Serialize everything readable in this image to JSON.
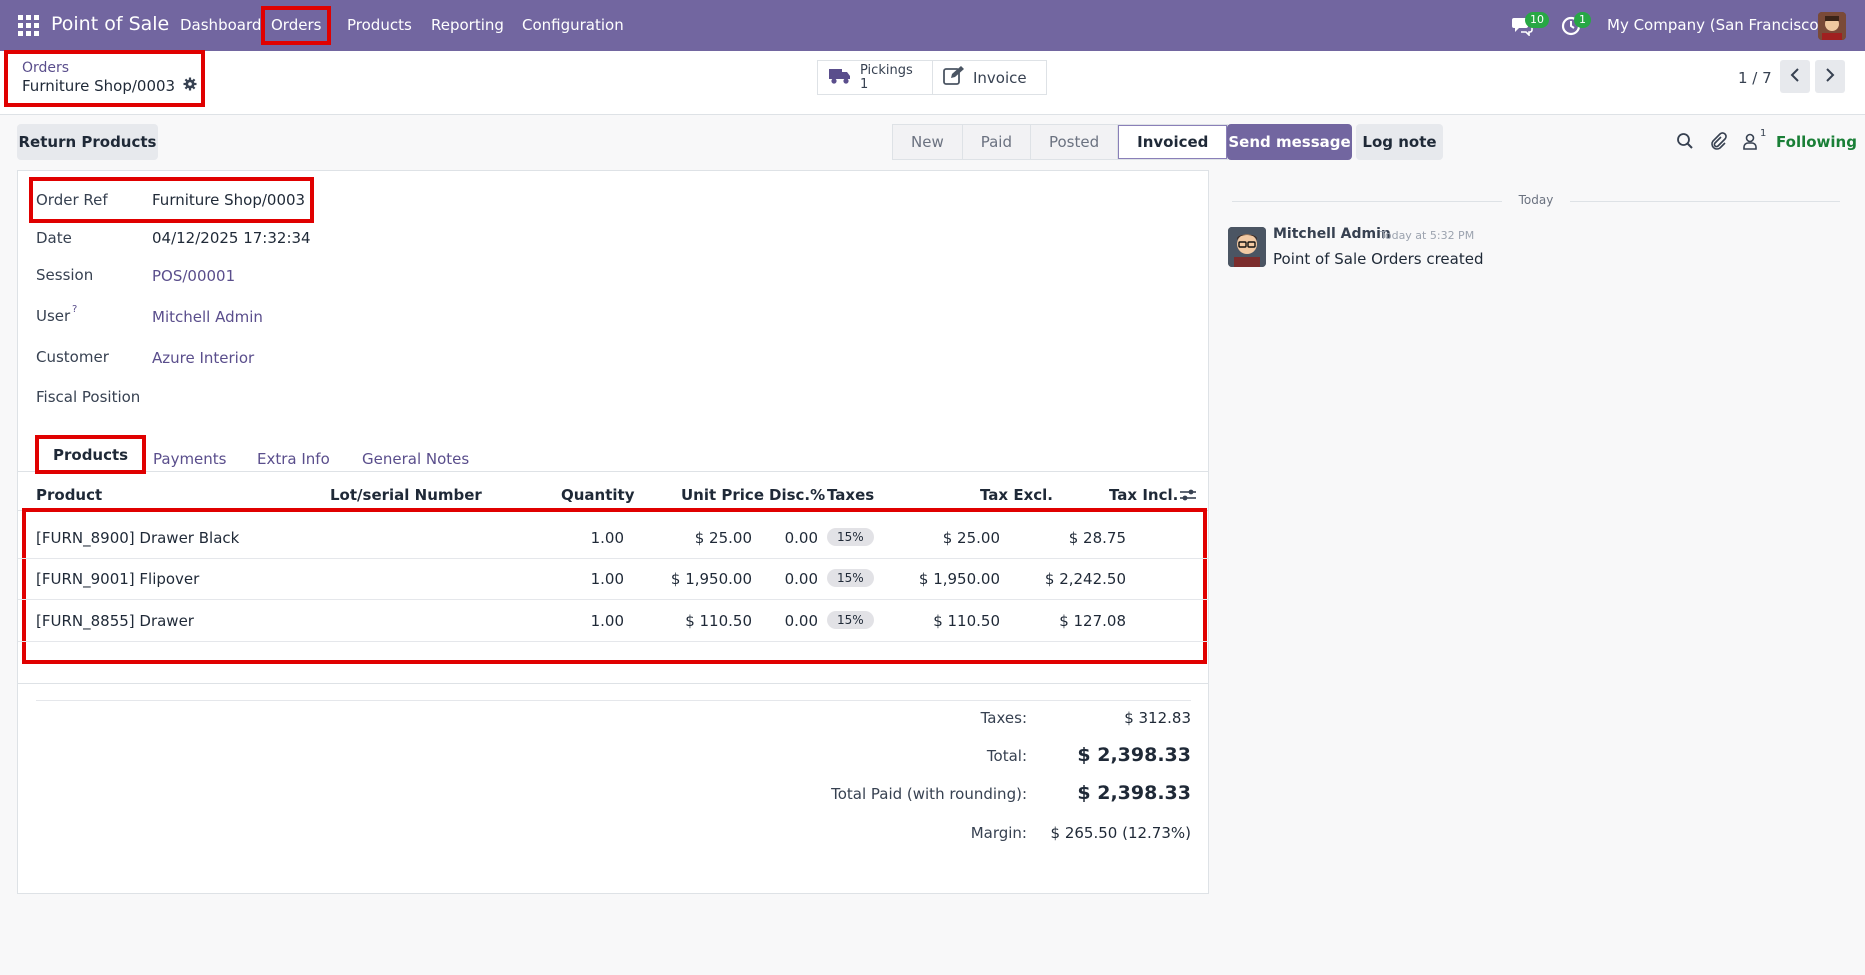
{
  "topbar": {
    "app_name": "Point of Sale",
    "menu": [
      "Dashboard",
      "Orders",
      "Products",
      "Reporting",
      "Configuration"
    ],
    "messages_count": "10",
    "activities_count": "1",
    "company": "My Company (San Francisco)"
  },
  "breadcrumb": {
    "parent": "Orders",
    "current": "Furniture Shop/0003"
  },
  "smart_buttons": {
    "pickings_label": "Pickings",
    "pickings_count": "1",
    "invoice_label": "Invoice"
  },
  "pager": {
    "text": "1 / 7"
  },
  "actions": {
    "return_products": "Return Products"
  },
  "status_steps": [
    "New",
    "Paid",
    "Posted",
    "Invoiced"
  ],
  "form": {
    "order_ref_label": "Order Ref",
    "order_ref": "Furniture Shop/0003",
    "date_label": "Date",
    "date": "04/12/2025 17:32:34",
    "session_label": "Session",
    "session": "POS/00001",
    "user_label": "User",
    "user_help": "?",
    "user": "Mitchell Admin",
    "customer_label": "Customer",
    "customer": "Azure Interior",
    "fiscal_label": "Fiscal Position",
    "fiscal": ""
  },
  "tabs": [
    "Products",
    "Payments",
    "Extra Info",
    "General Notes"
  ],
  "table": {
    "headers": [
      "Product",
      "Lot/serial Number",
      "Quantity",
      "Unit Price",
      "Disc.%",
      "Taxes",
      "Tax Excl.",
      "Tax Incl."
    ],
    "rows": [
      {
        "product": "[FURN_8900] Drawer Black",
        "qty": "1.00",
        "price": "$ 25.00",
        "disc": "0.00",
        "tax": "15%",
        "excl": "$ 25.00",
        "incl": "$ 28.75"
      },
      {
        "product": "[FURN_9001] Flipover",
        "qty": "1.00",
        "price": "$ 1,950.00",
        "disc": "0.00",
        "tax": "15%",
        "excl": "$ 1,950.00",
        "incl": "$ 2,242.50"
      },
      {
        "product": "[FURN_8855] Drawer",
        "qty": "1.00",
        "price": "$ 110.50",
        "disc": "0.00",
        "tax": "15%",
        "excl": "$ 110.50",
        "incl": "$ 127.08"
      }
    ]
  },
  "totals": {
    "taxes_label": "Taxes:",
    "taxes": "$ 312.83",
    "total_label": "Total:",
    "total": "$ 2,398.33",
    "paid_label": "Total Paid (with rounding):",
    "paid": "$ 2,398.33",
    "margin_label": "Margin:",
    "margin": "$ 265.50 (12.73%)"
  },
  "chatter": {
    "send_message": "Send message",
    "log_note": "Log note",
    "followers_count": "1",
    "following": "Following",
    "date_sep": "Today",
    "author": "Mitchell Admin",
    "time": "Today at 5:32 PM",
    "body": "Point of Sale Orders created"
  }
}
